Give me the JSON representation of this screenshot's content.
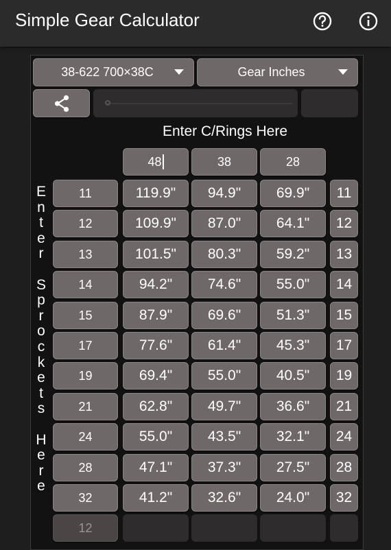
{
  "app": {
    "title": "Simple Gear Calculator",
    "help_icon": "help-circle-icon",
    "info_icon": "info-circle-icon"
  },
  "controls": {
    "wheel_size": "38-622 700×38C",
    "unit": "Gear Inches",
    "share_icon": "share-icon"
  },
  "chainring_prompt": "Enter C/Rings Here",
  "chainrings": [
    "48",
    "38",
    "28"
  ],
  "sprocket_prompt": "Enter Sprockets Here",
  "sprockets": [
    "11",
    "12",
    "13",
    "14",
    "15",
    "17",
    "19",
    "21",
    "24",
    "28",
    "32"
  ],
  "new_sprocket_placeholder": "12",
  "table": [
    [
      "119.9\"",
      "94.9\"",
      "69.9\""
    ],
    [
      "109.9\"",
      "87.0\"",
      "64.1\""
    ],
    [
      "101.5\"",
      "80.3\"",
      "59.2\""
    ],
    [
      "94.2\"",
      "74.6\"",
      "55.0\""
    ],
    [
      "87.9\"",
      "69.6\"",
      "51.3\""
    ],
    [
      "77.6\"",
      "61.4\"",
      "45.3\""
    ],
    [
      "69.4\"",
      "55.0\"",
      "40.5\""
    ],
    [
      "62.8\"",
      "49.7\"",
      "36.6\""
    ],
    [
      "55.0\"",
      "43.5\"",
      "32.1\""
    ],
    [
      "47.1\"",
      "37.3\"",
      "27.5\""
    ],
    [
      "41.2\"",
      "32.6\"",
      "24.0\""
    ]
  ],
  "colors": {
    "button": "#6f6868",
    "background": "#121212",
    "appbar": "#2b2b2b"
  }
}
